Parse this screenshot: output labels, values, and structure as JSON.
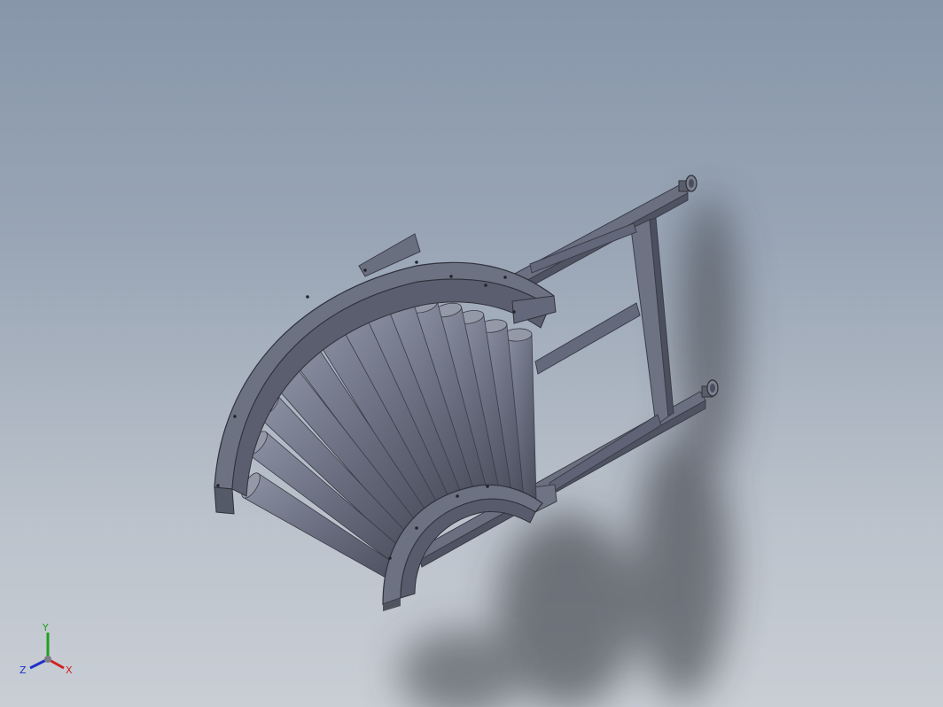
{
  "viewport": {
    "background_top": "#8796aa",
    "background_bottom": "#c9ced5",
    "model": "curved-roller-conveyor",
    "roller_count": 14,
    "leg_count": 2,
    "foot_count": 2
  },
  "triad": {
    "x_label": "X",
    "y_label": "Y",
    "z_label": "Z",
    "x_color": "#d22020",
    "y_color": "#20a020",
    "z_color": "#2030c8"
  }
}
